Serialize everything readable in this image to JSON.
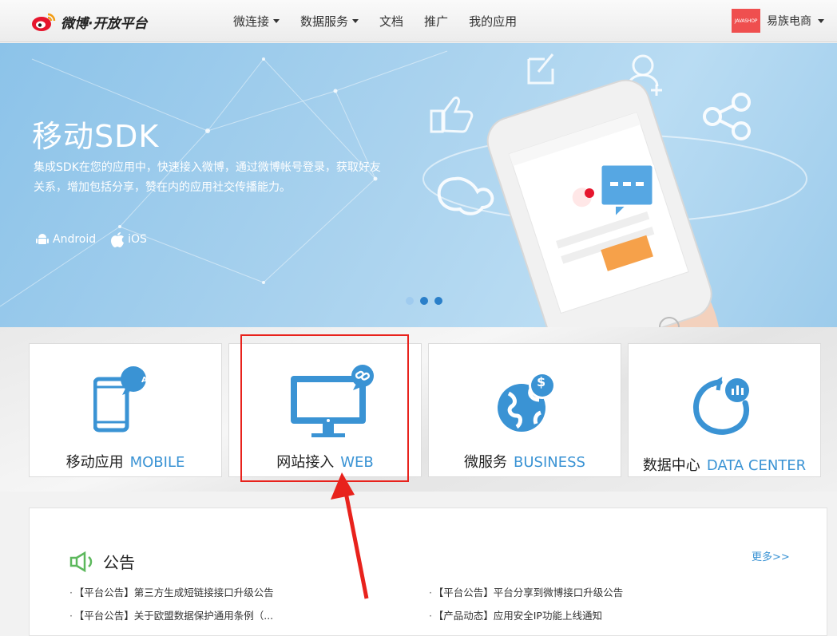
{
  "nav": {
    "logo_text": "微博·开放平台",
    "items": [
      {
        "label": "微连接",
        "dropdown": true
      },
      {
        "label": "数据服务",
        "dropdown": true
      },
      {
        "label": "文档",
        "dropdown": false
      },
      {
        "label": "推广",
        "dropdown": false
      },
      {
        "label": "我的应用",
        "dropdown": false
      }
    ],
    "user": {
      "avatar_text": "JAVASHOP",
      "name": "易族电商"
    }
  },
  "banner": {
    "title": "移动SDK",
    "description": "集成SDK在您的应用中，快速接入微博，通过微博帐号登录，获取好友关系，增加包括分享，赞在内的应用社交传播能力。",
    "platforms": [
      "Android",
      "iOS"
    ],
    "carousel": {
      "count": 3,
      "active_index": 1
    }
  },
  "cards": [
    {
      "cn": "移动应用",
      "en": "MOBILE",
      "icon": "mobile-app-icon",
      "badge": "APP"
    },
    {
      "cn": "网站接入",
      "en": "WEB",
      "icon": "monitor-link-icon"
    },
    {
      "cn": "微服务",
      "en": "BUSINESS",
      "icon": "globe-dollar-icon"
    },
    {
      "cn": "数据中心",
      "en": "DATA CENTER",
      "icon": "data-chart-icon"
    }
  ],
  "notice": {
    "title": "公告",
    "more": "更多>>",
    "items": [
      "【平台公告】第三方生成短链接接口升级公告",
      "【平台公告】平台分享到微博接口升级公告",
      "【平台公告】关于欧盟数据保护通用条例（...",
      "【产品动态】应用安全IP功能上线通知"
    ]
  },
  "colors": {
    "accent": "#3a93d4",
    "highlight": "#e8221c",
    "banner": "#a9d2ee"
  }
}
